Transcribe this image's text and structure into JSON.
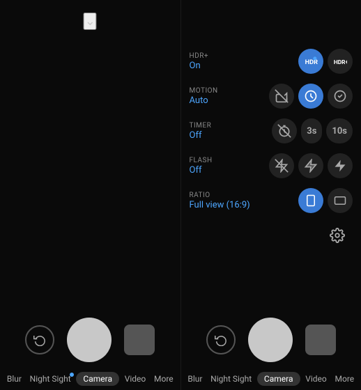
{
  "left_panel": {
    "chevron": "⌄",
    "bottom_nav": [
      {
        "label": "Blur",
        "active": false,
        "dot": false
      },
      {
        "label": "Night Sight",
        "active": false,
        "dot": true
      },
      {
        "label": "Camera",
        "active": true,
        "dot": false
      },
      {
        "label": "Video",
        "active": false,
        "dot": false
      },
      {
        "label": "More",
        "active": false,
        "dot": false
      }
    ]
  },
  "right_panel": {
    "settings": [
      {
        "id": "hdr",
        "title": "HDR+",
        "value": "On",
        "options": [
          {
            "label": "HDR●",
            "icon": "hdr-auto",
            "active": true
          },
          {
            "label": "HDR+",
            "icon": "hdr-plus",
            "active": false
          }
        ]
      },
      {
        "id": "motion",
        "title": "MOTION",
        "value": "Auto",
        "options": [
          {
            "label": "motion-off",
            "icon": "motion-off",
            "active": false
          },
          {
            "label": "motion-auto",
            "icon": "motion-auto",
            "active": true
          },
          {
            "label": "motion-on",
            "icon": "motion-on",
            "active": false
          }
        ]
      },
      {
        "id": "timer",
        "title": "TIMER",
        "value": "Off",
        "options": [
          {
            "label": "timer-off",
            "icon": "timer-off",
            "active": false
          },
          {
            "label": "3s",
            "text": "3s",
            "active": false
          },
          {
            "label": "10s",
            "text": "10s",
            "active": false
          }
        ]
      },
      {
        "id": "flash",
        "title": "FLASH",
        "value": "Off",
        "options": [
          {
            "label": "flash-off",
            "icon": "flash-off",
            "active": false
          },
          {
            "label": "flash-auto",
            "icon": "flash-auto",
            "active": false
          },
          {
            "label": "flash-on",
            "icon": "flash-on",
            "active": false
          }
        ]
      },
      {
        "id": "ratio",
        "title": "RATIO",
        "value": "Full view (16:9)",
        "options": [
          {
            "label": "ratio-full",
            "icon": "ratio-full",
            "active": true
          },
          {
            "label": "ratio-square",
            "icon": "ratio-square",
            "active": false
          }
        ]
      }
    ],
    "bottom_nav": [
      {
        "label": "Blur",
        "active": false,
        "dot": false
      },
      {
        "label": "Night Sight",
        "active": false,
        "dot": false
      },
      {
        "label": "Camera",
        "active": true,
        "dot": false
      },
      {
        "label": "Video",
        "active": false,
        "dot": false
      },
      {
        "label": "More",
        "active": false,
        "dot": false
      }
    ]
  }
}
